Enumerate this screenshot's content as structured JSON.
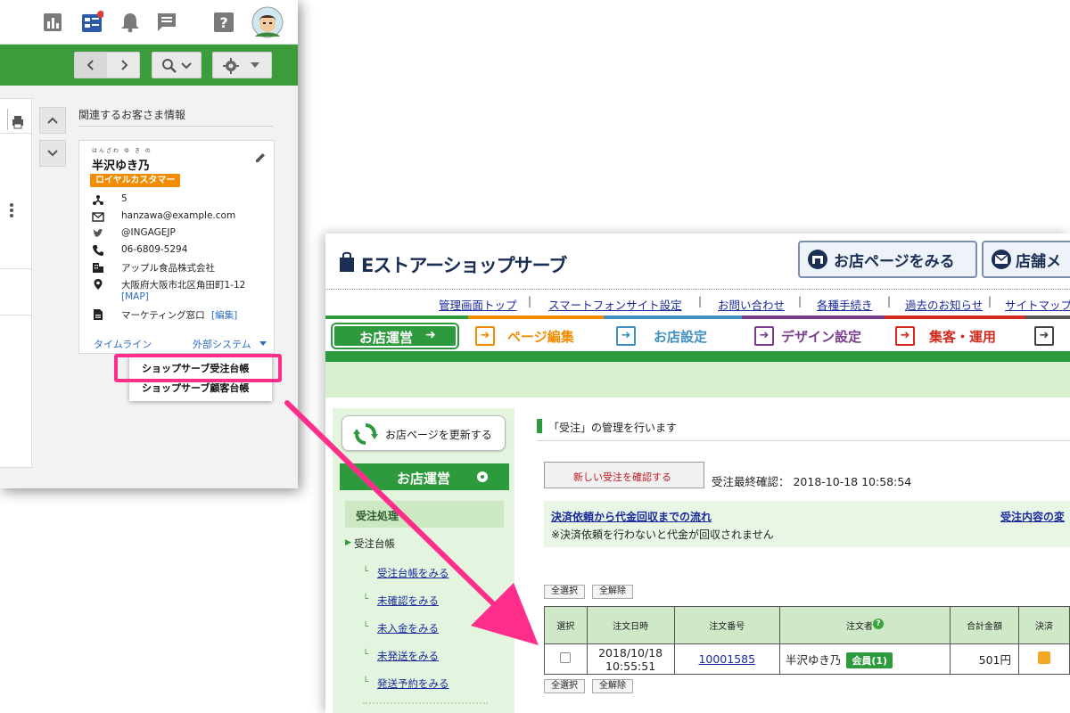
{
  "crm": {
    "related_title": "関連するお客さま情報",
    "customer": {
      "ruby": "はんざわ ゆ き の",
      "name": "半沢ゆき乃",
      "rank": "ロイヤルカスタマー",
      "connections": "5",
      "email": "hanzawa@example.com",
      "twitter": "@INGAGEJP",
      "phone": "06-6809-5294",
      "company": "アップル食品株式会社",
      "address": "大阪府大阪市北区角田町1-12",
      "map_link": "[MAP]",
      "note": "マーケティング窓口",
      "edit_link": "[編集]"
    },
    "footer": {
      "timeline": "タイムライン",
      "external": "外部システム"
    },
    "dropdown": {
      "items": [
        "ショップサーブ受注台帳",
        "ショップサーブ顧客台帳"
      ]
    },
    "icons": [
      "chart-icon",
      "board-icon",
      "bell-icon",
      "chat-icon",
      "help-icon",
      "avatar"
    ],
    "highlight_color": "#ff2e8a"
  },
  "shop": {
    "logo": "Eストアーショップサーブ",
    "header_buttons": [
      "お店ページをみる",
      "店舗メ"
    ],
    "top_links": [
      "管理画面トップ",
      "スマートフォンサイト設定",
      "お問い合わせ",
      "各種手続き",
      "過去のお知らせ",
      "サイトマップ"
    ],
    "nav_tabs": [
      "お店運営",
      "ページ編集",
      "お店設定",
      "デザイン設定",
      "集客・運用"
    ],
    "sidebar": {
      "refresh": "お店ページを更新する",
      "head": "お店運営",
      "sub": "受注処理",
      "section": "受注台帳",
      "links": [
        "受注台帳をみる",
        "未確認をみる",
        "未入金をみる",
        "未発送をみる",
        "発送予約をみる"
      ]
    },
    "main": {
      "title": "「受注」の管理を行います",
      "new_order_button": "新しい受注を確認する",
      "last_check": "受注最終確認：  2018-10-18 10:58:54",
      "info_link1": "決済依頼から代金回収までの流れ",
      "info_link2": "受注内容の変",
      "info_note": "※決済依頼を行わないと代金が回収されません",
      "select_all": "全選択",
      "clear_all": "全解除",
      "table": {
        "headers": [
          "選択",
          "注文日時",
          "注文番号",
          "注文者",
          "合計金額",
          "決済"
        ],
        "row": {
          "datetime_line1": "2018/10/18",
          "datetime_line2": "10:55:51",
          "order_no": "10001585",
          "customer": "半沢ゆき乃",
          "member": "会員(1)",
          "total": "501円"
        }
      }
    },
    "colors": {
      "brand_green": "#2e9a3e",
      "link_blue": "#1a2a9c",
      "accent_orange": "#f28c00"
    }
  }
}
